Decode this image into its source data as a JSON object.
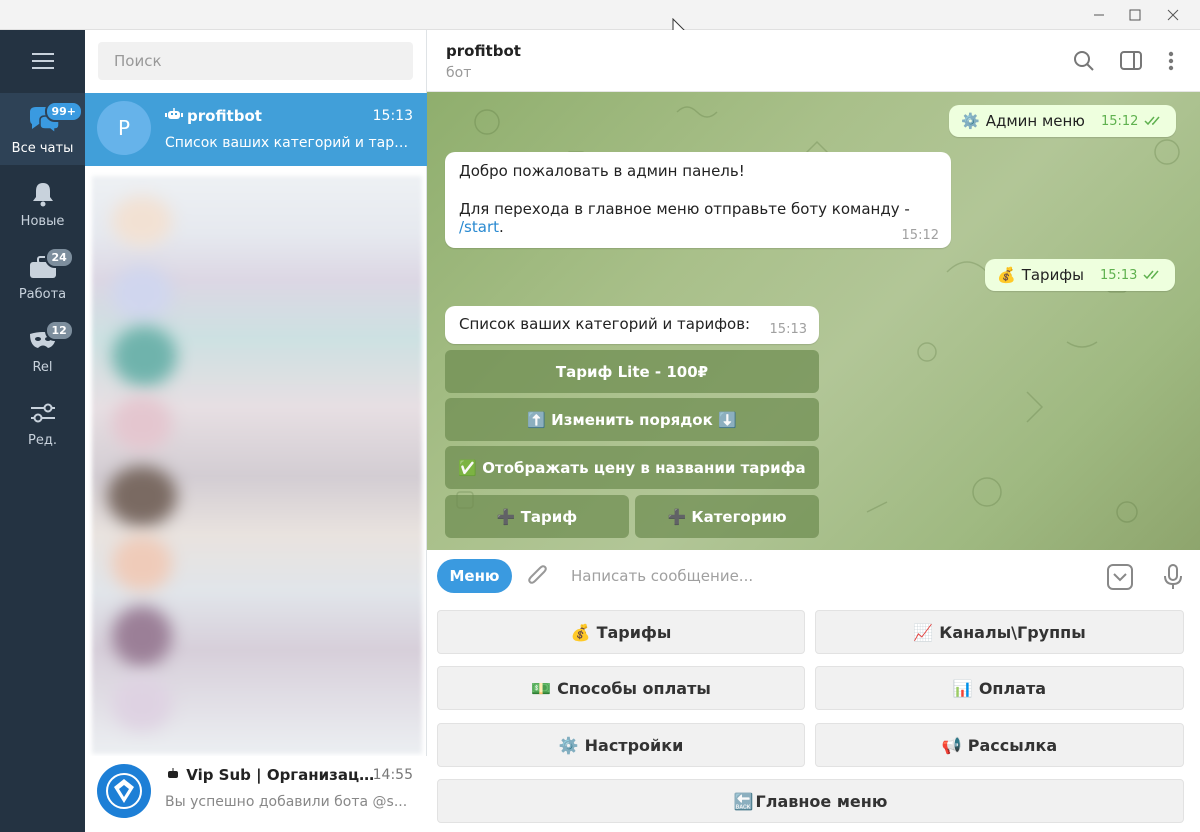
{
  "rail": {
    "items": [
      {
        "label": "Все чаты",
        "badge": "99+",
        "icon": "chats-icon"
      },
      {
        "label": "Новые",
        "badge": "",
        "icon": "bell-icon"
      },
      {
        "label": "Работа",
        "badge": "24",
        "icon": "briefcase-icon"
      },
      {
        "label": "Rel",
        "badge": "12",
        "icon": "mask-icon"
      },
      {
        "label": "Ред.",
        "badge": "",
        "icon": "sliders-icon"
      }
    ]
  },
  "search": {
    "placeholder": "Поиск"
  },
  "chats": [
    {
      "avatar_letter": "P",
      "name": "profitbot",
      "time": "15:13",
      "preview": "Список ваших категорий и тари..."
    },
    {
      "name": "Vip Sub | Организаци...",
      "time": "14:55",
      "preview": "Вы успешно добавили бота @s..."
    }
  ],
  "header": {
    "title": "profitbot",
    "subtitle": "бот"
  },
  "messages": {
    "m1": {
      "emoji": "⚙️",
      "text": "Админ меню",
      "time": "15:12"
    },
    "m2": {
      "line1": "Добро пожаловать в админ панель!",
      "line2": "Для перехода в главное меню отправьте боту команду - ",
      "link": "/start",
      "after": ".",
      "time": "15:12"
    },
    "m3": {
      "emoji": "💰",
      "text": "Тарифы",
      "time": "15:13"
    },
    "m4": {
      "text": "Список ваших категорий и тарифов:",
      "time": "15:13"
    }
  },
  "inline_buttons": {
    "b1": "Тариф Lite - 100₽",
    "b2": "⬆️ Изменить порядок ⬇️",
    "b3": "✅ Отображать цену в названии тарифа",
    "b4": "➕ Тариф",
    "b5": "➕ Категорию"
  },
  "composer": {
    "menu_label": "Меню",
    "placeholder": "Написать сообщение..."
  },
  "keyboard": {
    "k1": {
      "emoji": "💰",
      "label": "Тарифы"
    },
    "k2": {
      "emoji": "📈",
      "label": "Каналы\\Группы"
    },
    "k3": {
      "emoji": "💵",
      "label": "Способы оплаты"
    },
    "k4": {
      "emoji": "📊",
      "label": "Оплата"
    },
    "k5": {
      "emoji": "⚙️",
      "label": "Настройки"
    },
    "k6": {
      "emoji": "📢",
      "label": "Рассылка"
    },
    "k7": {
      "emoji": "🔙",
      "label": "Главное меню"
    }
  },
  "colors": {
    "accent": "#3a9ae0",
    "rail_bg": "#243342",
    "active_chat": "#419fd9",
    "outgoing_bubble": "#eeffde"
  }
}
